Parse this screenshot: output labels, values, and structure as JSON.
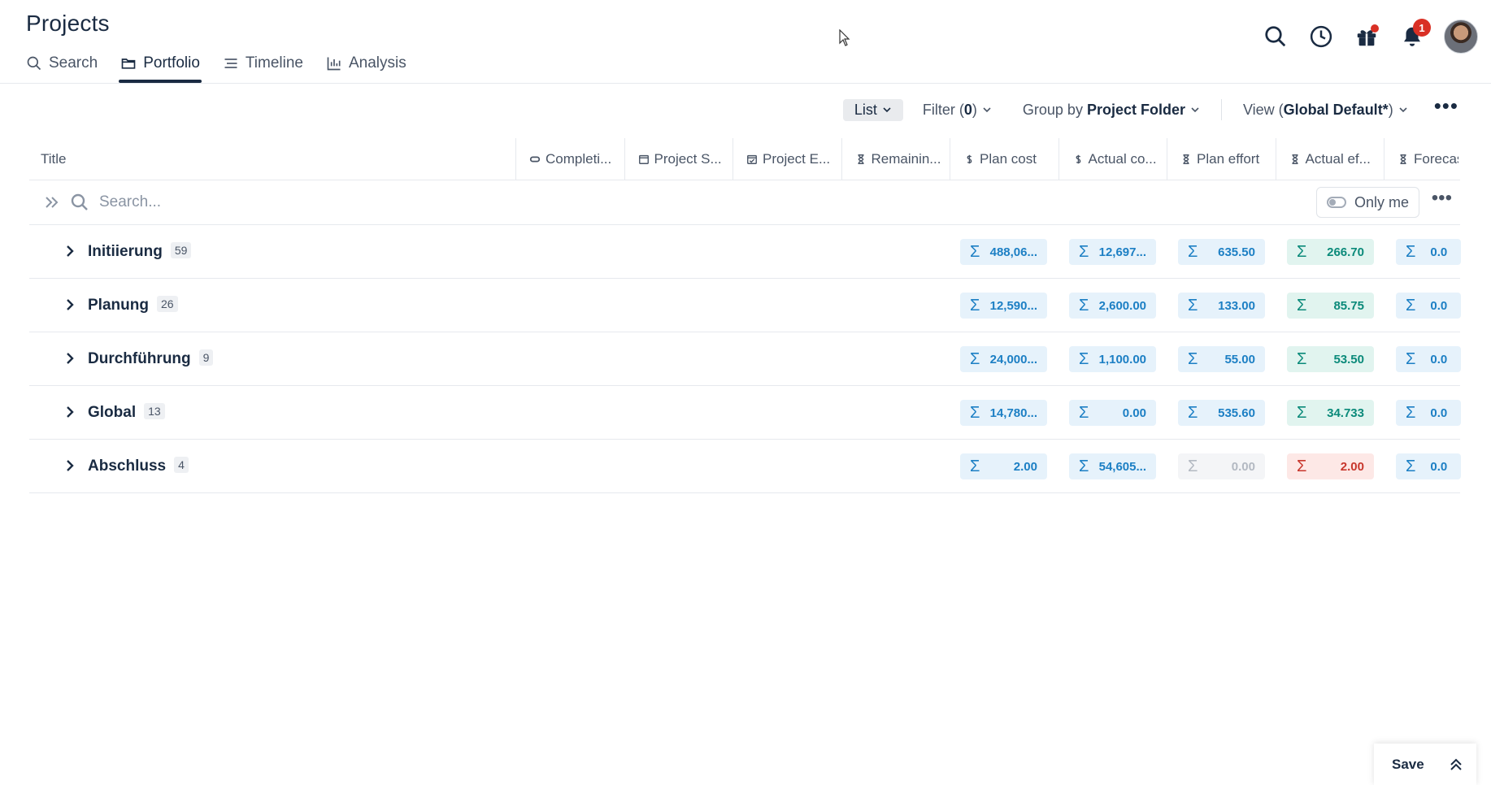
{
  "header": {
    "title": "Projects",
    "tabs": [
      {
        "label": "Search",
        "icon": "search-icon",
        "active": false
      },
      {
        "label": "Portfolio",
        "icon": "folder-icon",
        "active": true
      },
      {
        "label": "Timeline",
        "icon": "timeline-icon",
        "active": false
      },
      {
        "label": "Analysis",
        "icon": "bar-chart-icon",
        "active": false
      }
    ],
    "notifications_count": "1"
  },
  "toolbar": {
    "list_label": "List",
    "filter_label": "Filter (",
    "filter_count": "0",
    "filter_suffix": ")",
    "group_prefix": "Group by ",
    "group_value": "Project Folder",
    "view_prefix": "View (",
    "view_value": "Global Default*",
    "view_suffix": ")"
  },
  "table": {
    "title_header": "Title",
    "columns": [
      {
        "label": "Completi...",
        "icon": "link-icon"
      },
      {
        "label": "Project S...",
        "icon": "calendar-icon"
      },
      {
        "label": "Project E...",
        "icon": "calendar-check-icon"
      },
      {
        "label": "Remainin...",
        "icon": "hourglass-icon"
      },
      {
        "label": "Plan cost",
        "icon": "dollar-icon"
      },
      {
        "label": "Actual co...",
        "icon": "dollar-icon"
      },
      {
        "label": "Plan effort",
        "icon": "hourglass-icon"
      },
      {
        "label": "Actual ef...",
        "icon": "hourglass-icon"
      },
      {
        "label": "Forecas",
        "icon": "hourglass-icon"
      }
    ],
    "search_placeholder": "Search...",
    "only_me_label": "Only me",
    "groups": [
      {
        "name": "Initiierung",
        "count": "59",
        "plan_cost": "488,06...",
        "actual_cost": "12,697...",
        "plan_effort": "635.50",
        "actual_effort": "266.70",
        "forecast": "0.0"
      },
      {
        "name": "Planung",
        "count": "26",
        "plan_cost": "12,590...",
        "actual_cost": "2,600.00",
        "plan_effort": "133.00",
        "actual_effort": "85.75",
        "forecast": "0.0"
      },
      {
        "name": "Durchführung",
        "count": "9",
        "plan_cost": "24,000...",
        "actual_cost": "1,100.00",
        "plan_effort": "55.00",
        "actual_effort": "53.50",
        "forecast": "0.0"
      },
      {
        "name": "Global",
        "count": "13",
        "plan_cost": "14,780...",
        "actual_cost": "0.00",
        "plan_effort": "535.60",
        "actual_effort": "34.733",
        "forecast": "0.0"
      },
      {
        "name": "Abschluss",
        "count": "4",
        "plan_cost": "2.00",
        "actual_cost": "54,605...",
        "plan_effort": "0.00",
        "actual_effort": "2.00",
        "forecast": "0.0"
      }
    ],
    "sigma": "Σ"
  },
  "save_label": "Save",
  "colors": {
    "blue_cell": "#e6f2fb",
    "teal_cell": "#e1f4ef",
    "red_cell": "#fde8e6",
    "accent": "#1a2b42",
    "badge": "#d93025"
  }
}
